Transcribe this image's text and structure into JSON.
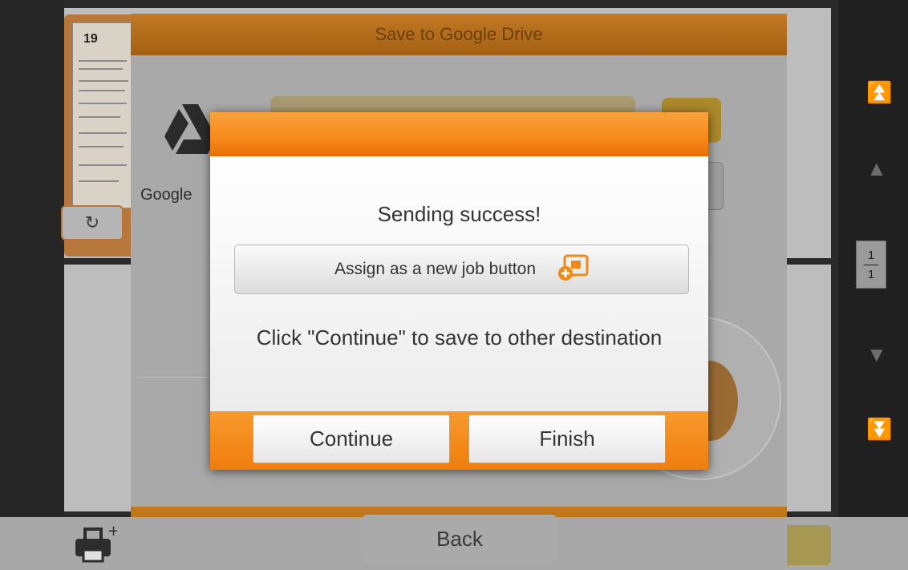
{
  "background": {
    "panel_title": "Save to Google Drive",
    "service_label": "Google",
    "back_label": "Back",
    "thumbnail_page_number": "19",
    "page_indicator": {
      "current": "1",
      "total": "1"
    }
  },
  "dialog": {
    "title": "Sending success!",
    "assign_button_label": "Assign as a new job button",
    "message": "Click \"Continue\" to save to other destination",
    "continue_label": "Continue",
    "finish_label": "Finish"
  },
  "icons": {
    "rotate": "rotate-icon",
    "assign": "new-job-button-icon",
    "printer": "printer-add-icon",
    "drive": "google-drive-icon"
  },
  "colors": {
    "accent_orange": "#f7891a",
    "dialog_bg": "#ededed"
  }
}
